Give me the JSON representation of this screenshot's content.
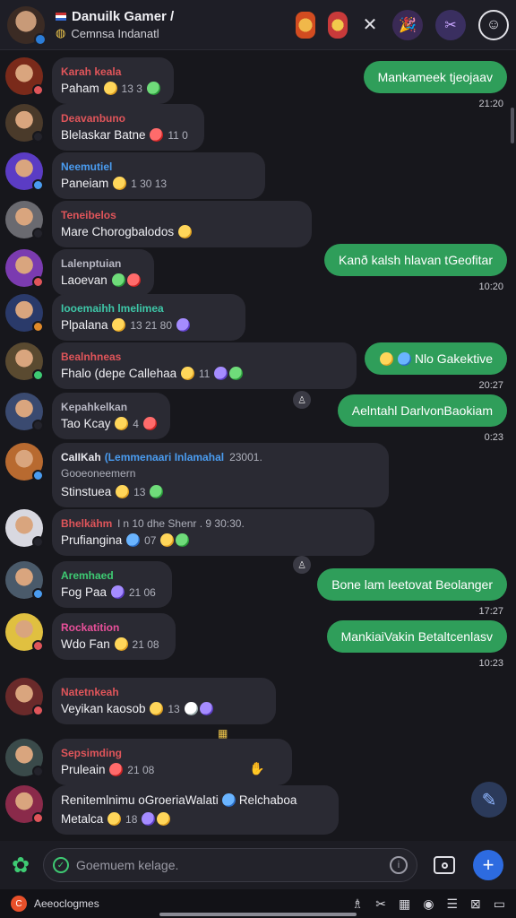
{
  "header": {
    "title": "Danuilk Gamer /",
    "subtitle": "Cemnsa Indanatl",
    "actions": [
      "fire-icon",
      "bomb-icon",
      "close-icon",
      "party-icon",
      "game-icon",
      "camera-icon"
    ]
  },
  "messages_in": [
    {
      "sender": "Karah keala",
      "sender_color": "#e0555a",
      "text": "Paham",
      "meta": "13 3",
      "emojis": [
        "e-y",
        "e-g"
      ]
    },
    {
      "sender": "Deavanbuno",
      "sender_color": "#e0555a",
      "text": "Blelaskar Batne",
      "meta": "11 0",
      "emojis": [
        "e-r"
      ]
    },
    {
      "sender": "Neemutiel",
      "sender_color": "#4a9cf0",
      "text": "Paneiam",
      "meta": "1 30 13",
      "emojis": [
        "e-y"
      ]
    },
    {
      "sender": "Teneibelos",
      "sender_color": "#e0555a",
      "text": "Mare Chorogbalodos",
      "meta": "",
      "emojis": [
        "e-y"
      ]
    },
    {
      "sender": "Lalenptuian",
      "sender_color": "#b8b8c4",
      "text": "Laoevan",
      "meta": "",
      "emojis": [
        "e-g",
        "e-r"
      ]
    },
    {
      "sender": "Iooemaihh lmelimea",
      "sender_color": "#3ec7a8",
      "text": "Plpalana",
      "meta": "13 21 80",
      "emojis": [
        "e-y",
        "e-p"
      ]
    },
    {
      "sender": "Bealnhneas",
      "sender_color": "#e0555a",
      "text": "Fhalo (depe Callehaa",
      "meta": "11",
      "emojis": [
        "e-y",
        "e-p",
        "e-g"
      ]
    },
    {
      "sender": "Kepahkelkan",
      "sender_color": "#b8b8c4",
      "text": "Tao Kcay",
      "meta": "4",
      "emojis": [
        "e-y",
        "e-r"
      ]
    },
    {
      "sender": "CaIIKah",
      "sender2": "(Lemmenaari Inlamahal",
      "sender_meta": "23001.",
      "sub_line": "Gooeoneemern",
      "sender_color": "#e8e8ee",
      "text": "Stinstuea",
      "meta": "13",
      "emojis": [
        "e-y",
        "e-g"
      ]
    },
    {
      "sender": "Bhelkähm",
      "sender_meta": "l n 10 dhe Shenr . 9 30:30.",
      "sender_color": "#e0555a",
      "text": "Prufiangina",
      "meta": "07",
      "emojis": [
        "e-b",
        "e-y",
        "e-g"
      ]
    },
    {
      "sender": "Aremhaed",
      "sender_color": "#3ecb73",
      "text": "Fog Paa",
      "meta": "21 06",
      "emojis": [
        "e-p"
      ]
    },
    {
      "sender": "Rockatition",
      "sender_color": "#e8509a",
      "text": "Wdo Fan",
      "meta": "21 08",
      "emojis": [
        "e-y"
      ]
    },
    {
      "sender": "Natetnkeah",
      "sender_color": "#e0555a",
      "text": "Veyikan kaosob",
      "meta": "13",
      "emojis": [
        "e-y",
        "e-w",
        "e-p"
      ]
    },
    {
      "sender": "Sepsimding",
      "sender_color": "#e0555a",
      "text": "Pruleain",
      "meta": "21 08",
      "emojis": [
        "e-r"
      ]
    },
    {
      "sender": "",
      "sender_color": "#e8e8ee",
      "text": "Renitemlnimu oGroeriaWalati",
      "text_extra": "Relchaboa",
      "line2": "Metalca",
      "meta": "18",
      "emojis": [
        "e-y",
        "e-p",
        "e-y"
      ]
    }
  ],
  "messages_out": [
    {
      "text": "Mankameek tjeojaav",
      "time": "21:20"
    },
    {
      "text": "Kanð kalsh hlavan tGeofitar",
      "time": "10:20"
    },
    {
      "text": "Nlo Gakektive",
      "time": "20:27",
      "emojis": [
        "e-y",
        "e-b"
      ]
    },
    {
      "text": "Aelntahl DarlvonBaokiam",
      "time": "0:23"
    },
    {
      "text": "Bone lam leetovat Beolanger",
      "time": "17:27"
    },
    {
      "text": "MankiaiVakin Betaltcenlasv",
      "time": "10:23"
    }
  ],
  "input": {
    "placeholder": "Goemuem kelage."
  },
  "bottom": {
    "label": "Aeeoclogmes"
  },
  "colors": {
    "accent_green": "#2f9e5a",
    "background": "#17171c",
    "bubble_in": "#2a2a33",
    "send_blue": "#2d6be0"
  }
}
